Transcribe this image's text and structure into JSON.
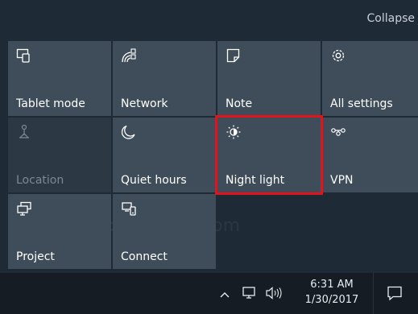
{
  "header": {
    "collapse_label": "Collapse"
  },
  "tiles": [
    {
      "label": "Tablet mode",
      "icon": "tablet-mode-icon",
      "state": "on"
    },
    {
      "label": "Network",
      "icon": "network-icon",
      "state": "on"
    },
    {
      "label": "Note",
      "icon": "note-icon",
      "state": "on"
    },
    {
      "label": "All settings",
      "icon": "settings-icon",
      "state": "on"
    },
    {
      "label": "Location",
      "icon": "location-icon",
      "state": "off"
    },
    {
      "label": "Quiet hours",
      "icon": "moon-icon",
      "state": "on"
    },
    {
      "label": "Night light",
      "icon": "night-light-icon",
      "state": "on",
      "highlighted": true
    },
    {
      "label": "VPN",
      "icon": "vpn-icon",
      "state": "on"
    },
    {
      "label": "Project",
      "icon": "project-icon",
      "state": "on"
    },
    {
      "label": "Connect",
      "icon": "connect-icon",
      "state": "on"
    }
  ],
  "taskbar": {
    "time": "6:31 AM",
    "date": "1/30/2017",
    "icons": [
      "chevron-up-icon",
      "network-icon",
      "volume-icon",
      "action-center-icon"
    ]
  },
  "colors": {
    "tile_on": "#3e4d59",
    "tile_off": "#2c3843",
    "highlight": "#e4121b",
    "taskbar": "#151c24"
  }
}
